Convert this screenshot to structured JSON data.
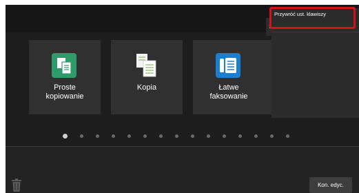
{
  "tiles": [
    {
      "label_line1": "Proste",
      "label_line2": "kopiowanie",
      "icon": "copy-easy-icon"
    },
    {
      "label_line1": "Kopia",
      "label_line2": "",
      "icon": "copy-icon"
    },
    {
      "label_line1": "Łatwe",
      "label_line2": "faksowanie",
      "icon": "fax-easy-icon"
    }
  ],
  "pagination": {
    "current_page": 1,
    "total_pages": 15
  },
  "side_panel": {
    "menu_item": "Przywróć ust. klawiszy",
    "toggle_icon": "chevron-right-icon"
  },
  "footer": {
    "edit_done_label": "Kon. edyc.",
    "trash_icon": "trash-icon"
  },
  "colors": {
    "highlight": "#d4121e",
    "tile_green": "#2e9b6a",
    "tile_blue": "#1a7fd0"
  }
}
